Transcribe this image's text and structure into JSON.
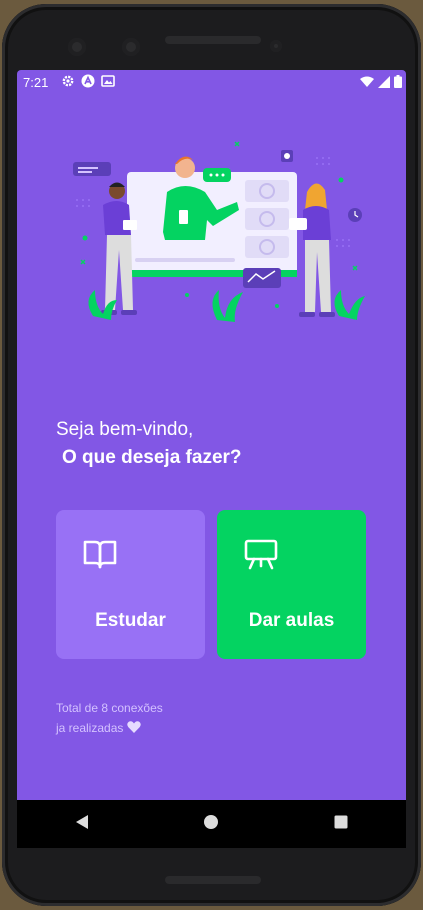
{
  "status_bar": {
    "time": "7:21",
    "icons_left": [
      "gear-icon",
      "accessibility-icon",
      "gallery-icon"
    ],
    "icons_right": [
      "wifi-icon",
      "signal-icon",
      "battery-icon"
    ]
  },
  "landing": {
    "greeting_line1": "Seja bem-vindo,",
    "greeting_line2": "O que deseja fazer?",
    "study_button": {
      "label": "Estudar",
      "icon": "book-open-icon"
    },
    "teach_button": {
      "label": "Dar aulas",
      "icon": "presentation-board-icon"
    },
    "connections_line1": "Total de 8 conexões",
    "connections_line2": "ja realizadas",
    "connections_icon": "purple-heart-icon"
  },
  "nav_bar": {
    "buttons": [
      "back-icon",
      "home-icon",
      "recents-icon"
    ]
  },
  "colors": {
    "background": "#8257e5",
    "study_button": "#9871f5",
    "teach_button": "#04d361",
    "text": "#ffffff",
    "connections_text": "#d4c2ff"
  }
}
